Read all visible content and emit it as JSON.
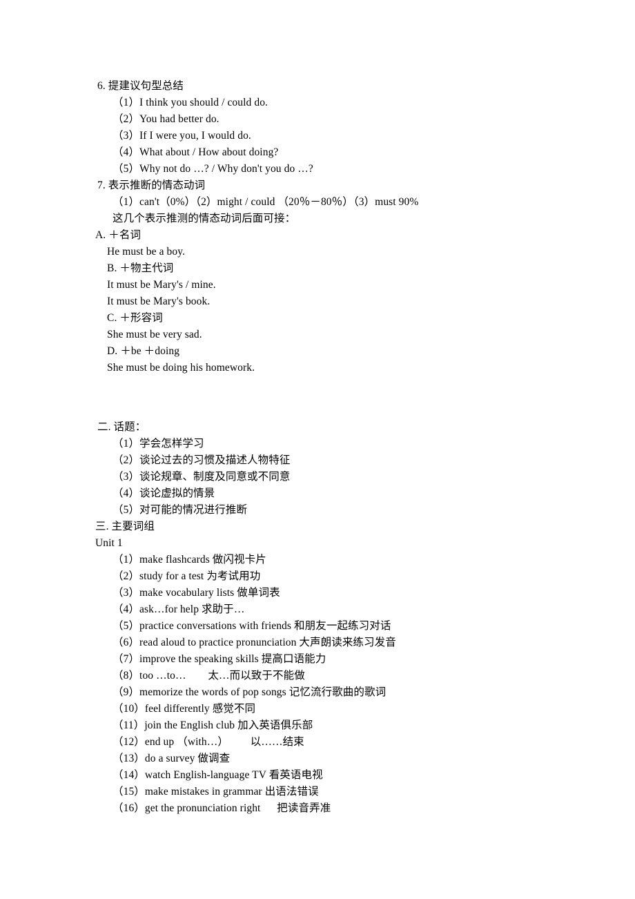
{
  "document": {
    "sections": [
      {
        "id": "section-6",
        "heading": "6. 提建议句型总结",
        "heading_indent": "ind-1",
        "items": [
          "（1）I think you should / could do.",
          "（2）You had better do.",
          "（3）If I were you, I would do.",
          "（4）What about / How about doing?",
          "（5）Why not do …? / Why don't you do …?"
        ]
      },
      {
        "id": "section-7",
        "heading": "7. 表示推断的情态动词",
        "heading_indent": "ind-1",
        "items": [
          "（1）can't（0%）（2）might / could （20％－80％）（3）must 90%"
        ],
        "note": "这几个表示推测的情态动词后面可接：",
        "subsections": [
          {
            "label": "A. ＋名词",
            "label_indent": "ind-0",
            "example": "He must be a boy."
          },
          {
            "label": "B. ＋物主代词",
            "label_indent": "ind-2",
            "example": "It must be Mary's / mine.",
            "example2": "It must be Mary's book."
          },
          {
            "label": "C. ＋形容词",
            "label_indent": "ind-2",
            "example": "She must be very sad."
          },
          {
            "label": "D. ＋be ＋doing",
            "label_indent": "ind-2",
            "example": "She must be doing his homework."
          }
        ]
      },
      {
        "id": "section-topics",
        "heading": "二. 话题：",
        "heading_indent": "ind-1",
        "items": [
          "（1）学会怎样学习",
          "（2）谈论过去的习惯及描述人物特征",
          "（3）谈论规章、制度及同意或不同意",
          "（4）谈论虚拟的情景",
          "（5）对可能的情况进行推断"
        ]
      },
      {
        "id": "section-phrases",
        "heading": "三. 主要词组",
        "heading_indent": "ind-0",
        "unit_label": "Unit 1",
        "items": [
          "（1）make flashcards 做闪视卡片",
          "（2）study for a test 为考试用功",
          "（3）make vocabulary lists 做单词表",
          "（4）ask…for help 求助于…",
          "（5）practice conversations with friends 和朋友一起练习对话",
          "（6）read aloud to practice pronunciation 大声朗读来练习发音",
          "（7）improve the speaking skills 提高口语能力",
          "（8）too …to…        太…而以致于不能做",
          "（9）memorize the words of pop songs 记忆流行歌曲的歌词",
          "（10）feel differently 感觉不同",
          "（11）join the English club 加入英语俱乐部",
          "（12）end up （with…）        以……结束",
          "（13）do a survey 做调查",
          "（14）watch English-language TV 看英语电视",
          "（15）make mistakes in grammar 出语法错误",
          "（16）get the pronunciation right      把读音弄准"
        ]
      }
    ]
  }
}
